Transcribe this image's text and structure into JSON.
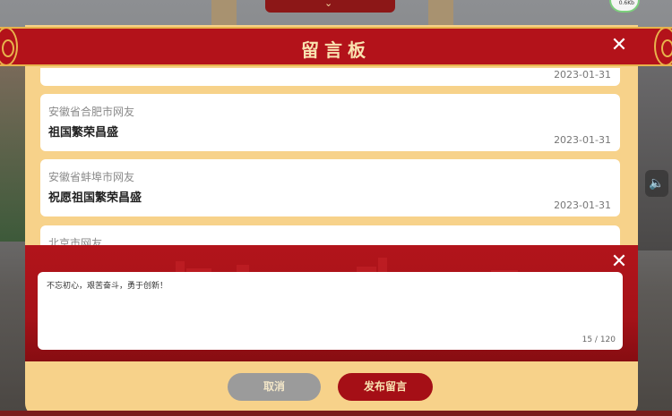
{
  "dialog": {
    "title": "留言板",
    "close_icon": "close-icon"
  },
  "messages": [
    {
      "author": "",
      "content": "",
      "date": "2023-01-31"
    },
    {
      "author": "安徽省合肥市网友",
      "content": "祖国繁荣昌盛",
      "date": "2023-01-31"
    },
    {
      "author": "安徽省蚌埠市网友",
      "content": "祝愿祖国繁荣昌盛",
      "date": "2023-01-31"
    },
    {
      "author": "北京市网友",
      "content": "",
      "date": ""
    }
  ],
  "composer": {
    "text": "不忘初心，艰苦奋斗，勇于创新！",
    "counter": "15 / 120",
    "close_icon": "close-icon"
  },
  "buttons": {
    "cancel": "取消",
    "publish": "发布留言"
  },
  "hud": {
    "speed_text": "0.6Kb",
    "volume_icon": "speaker-icon"
  },
  "colors": {
    "primary_red": "#b3121a",
    "panel_cream": "#f7d28a",
    "gold_border": "#e8b34c",
    "cancel_gray": "#9b9b9b"
  }
}
